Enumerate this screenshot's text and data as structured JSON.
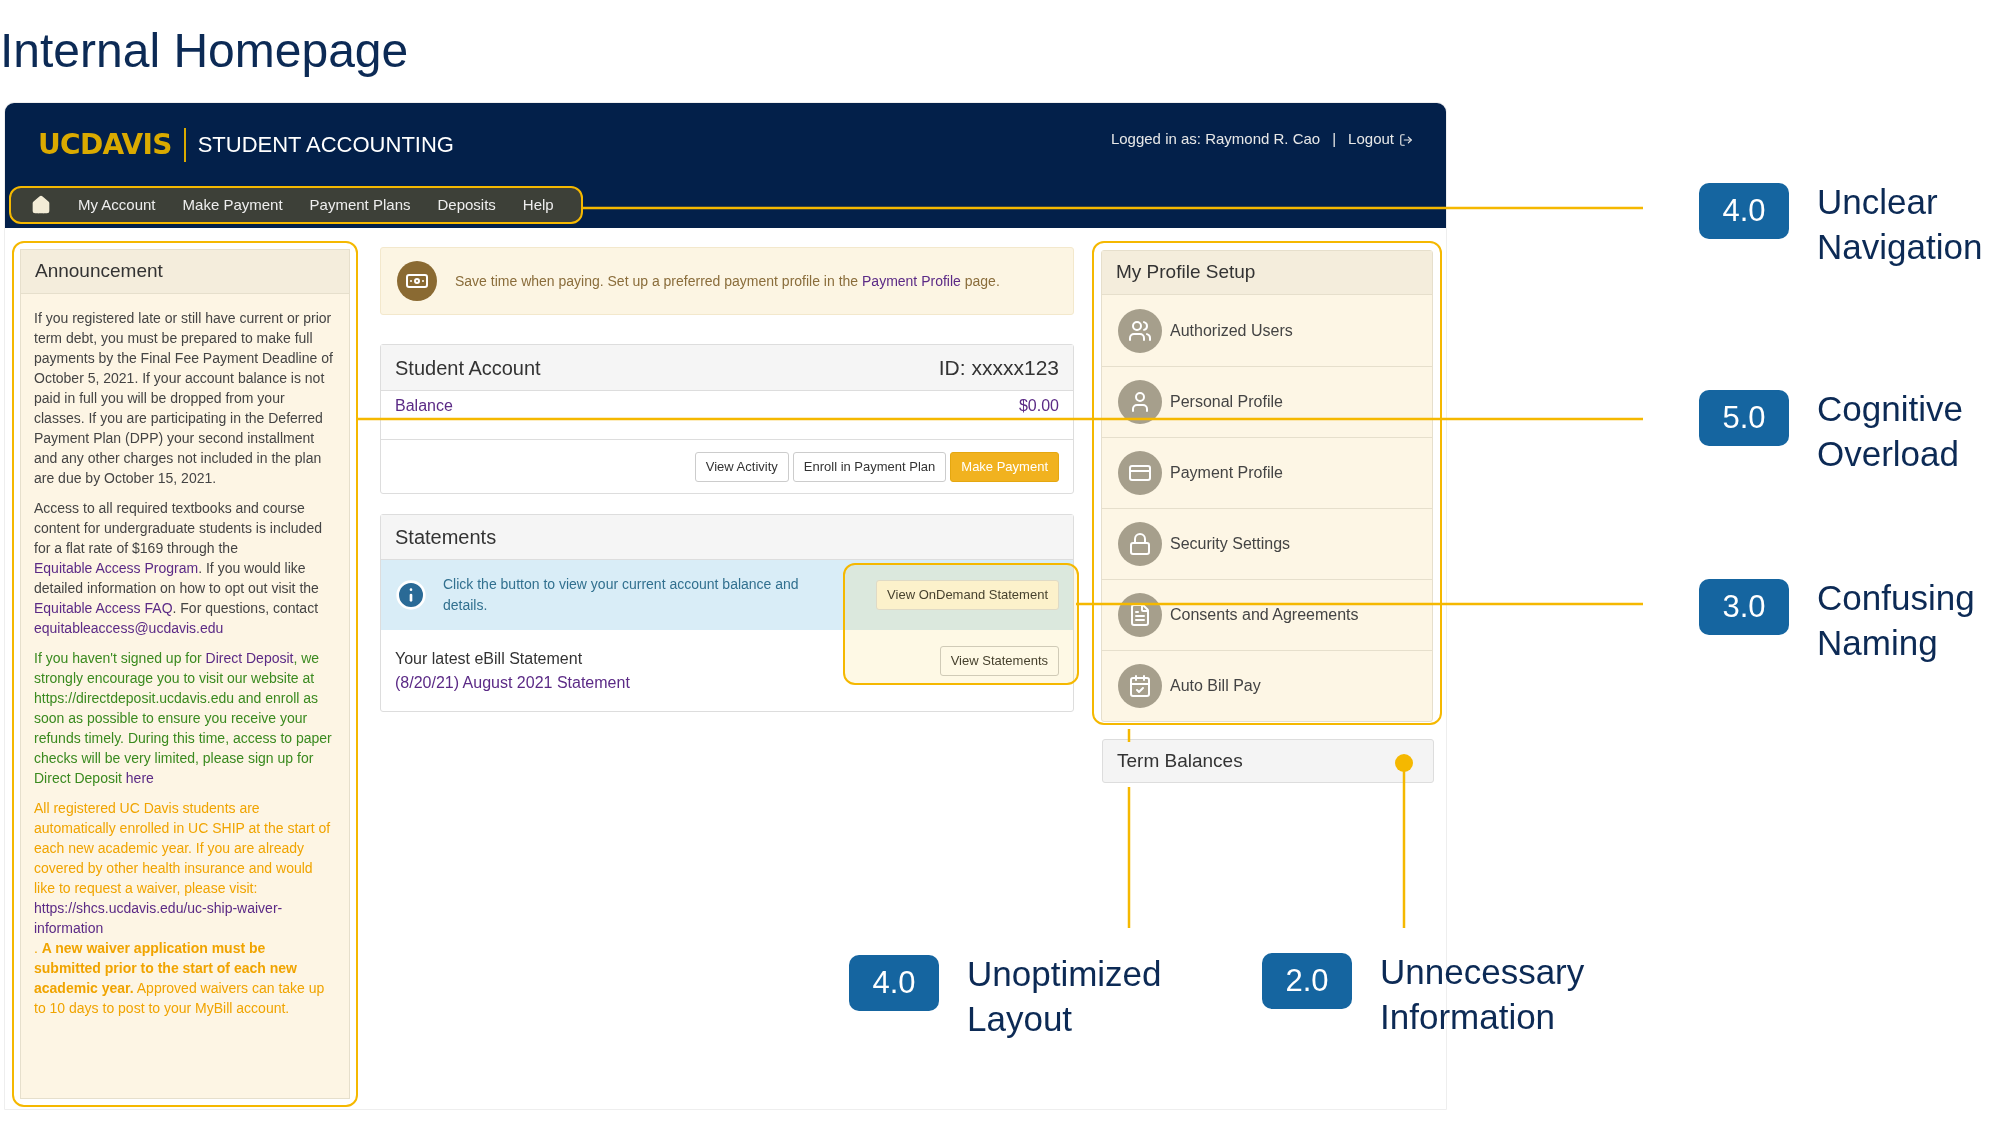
{
  "title": "Internal Homepage",
  "header": {
    "logo": "UCDAVIS",
    "app_name": "STUDENT ACCOUNTING",
    "user": "Logged in as: Raymond R. Cao",
    "separator": "|",
    "logout": "Logout"
  },
  "nav": {
    "highlighted": true,
    "items": [
      "My Account",
      "Make Payment",
      "Payment Plans",
      "Deposits",
      "Help"
    ]
  },
  "announcement": {
    "title": "Announcement",
    "highlighted": true,
    "paragraphs": [
      {
        "color": "#444444",
        "parts": [
          {
            "text": "If you registered late or still have current or prior term debt, you must be prepared to make full payments by the Final Fee Payment Deadline of October 5, 2021.  If your account balance is not paid in full you will be dropped from your classes.  If you are participating in the Deferred Payment Plan (DPP) your second installment and any other charges not included in the plan are due by October 15, 2021.",
            "kind": "text"
          }
        ]
      },
      {
        "color": "#444444",
        "parts": [
          {
            "text": "Access to all required textbooks and course content for undergraduate students is included for a flat rate of $169 through the ",
            "kind": "text"
          },
          {
            "text": "Equitable Access Program",
            "kind": "link"
          },
          {
            "text": ".   If you would like detailed information on how to opt out visit the ",
            "kind": "text"
          },
          {
            "text": "Equitable Access FAQ",
            "kind": "link"
          },
          {
            "text": ". For questions, contact ",
            "kind": "text"
          },
          {
            "text": "equitableaccess@ucdavis.edu",
            "kind": "link"
          }
        ]
      },
      {
        "color": "#3a8a1f",
        "parts": [
          {
            "text": "If you haven't signed up for ",
            "kind": "text"
          },
          {
            "text": "Direct Deposit",
            "kind": "link"
          },
          {
            "text": ", we strongly encourage you to visit our website at https://directdeposit.ucdavis.edu and enroll as soon as possible to ensure you receive your refunds timely. During this time, access to paper checks will be very limited, please sign up for Direct Deposit ",
            "kind": "text"
          },
          {
            "text": "here",
            "kind": "link"
          }
        ]
      },
      {
        "color": "#f0a400",
        "parts": [
          {
            "text": "All registered UC Davis students are automatically enrolled in UC SHIP at the start of each new academic year. If you are already covered by other health insurance and would like to request a waiver, please visit: ",
            "kind": "text"
          },
          {
            "text": "https://shcs.ucdavis.edu/uc-ship-waiver-information",
            "kind": "link"
          },
          {
            "text": ". **A new waiver application must be submitted prior to the start of each new academic year.** Approved waivers can take up to 10 days to post to your MyBill account.",
            "kind": "text"
          }
        ]
      }
    ]
  },
  "alert": {
    "parts": [
      {
        "text": "Save time when paying. Set up a preferred payment profile in the ",
        "kind": "text"
      },
      {
        "text": "Payment Profile",
        "kind": "link"
      },
      {
        "text": " page.",
        "kind": "text"
      }
    ]
  },
  "student_account": {
    "title": "Student Account",
    "id": "ID: xxxxx123",
    "balance_label": "Balance",
    "balance": "$0.00",
    "buttons": [
      {
        "label": "View Activity",
        "kind": "default"
      },
      {
        "label": "Enroll in Payment Plan",
        "kind": "default"
      },
      {
        "label": "Make Payment",
        "kind": "primary"
      }
    ]
  },
  "statements": {
    "title": "Statements",
    "info": "Click the button to view your current account balance and details.",
    "ondemand_button": "View OnDemand Statement",
    "latest_label": "Your latest eBill Statement",
    "latest_link": "(8/20/21) August 2021 Statement",
    "view_button": "View Statements",
    "highlighted": true
  },
  "profile_setup": {
    "title": "My Profile Setup",
    "highlighted": true,
    "items": [
      "Authorized Users",
      "Personal Profile",
      "Payment Profile",
      "Security Settings",
      "Consents and Agreements",
      "Auto Bill Pay"
    ]
  },
  "term_balances": {
    "title": "Term Balances"
  },
  "callouts": [
    {
      "score": "4.0",
      "label": "Unclear Navigation"
    },
    {
      "score": "5.0",
      "label": "Cognitive Overload"
    },
    {
      "score": "3.0",
      "label": "Confusing Naming"
    },
    {
      "score": "4.0",
      "label": "Unoptimized Layout"
    },
    {
      "score": "2.0",
      "label": "Unnecessary Information"
    }
  ]
}
